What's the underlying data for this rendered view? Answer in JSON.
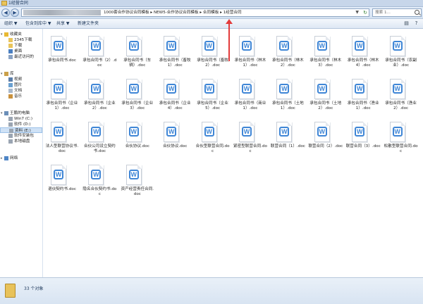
{
  "window": {
    "title": "1经营合同"
  },
  "address": {
    "path_segments": [
      "1000套合作协议合同模板",
      "NEW5-合作协议合同模板",
      "合同模板",
      "1经营合同"
    ],
    "separator": "▸",
    "dropdown": "▼",
    "refresh": "↻"
  },
  "search": {
    "placeholder": "搜索 1..."
  },
  "nav_buttons": {
    "back": "◀",
    "forward": "▶"
  },
  "commands": {
    "organize": "组织 ▼",
    "include_in_library": "包含到库中 ▼",
    "share": "共享 ▼",
    "new_folder": "新建文件夹",
    "view": "▤",
    "help": "?"
  },
  "sidebar": {
    "items": [
      {
        "label": "收藏夹",
        "icon": "star-icon",
        "group": true,
        "expand": "▾"
      },
      {
        "label": "2345下载",
        "icon": "download-folder-icon"
      },
      {
        "label": "下载",
        "icon": "download-folder-icon"
      },
      {
        "label": "桌面",
        "icon": "desktop-icon"
      },
      {
        "label": "最近访问的",
        "icon": "recent-icon"
      },
      {
        "label": "库",
        "icon": "library-icon",
        "group": true,
        "expand": "▾"
      },
      {
        "label": "视频",
        "icon": "video-icon"
      },
      {
        "label": "图片",
        "icon": "picture-icon"
      },
      {
        "label": "文档",
        "icon": "document-icon"
      },
      {
        "label": "音乐",
        "icon": "music-icon"
      },
      {
        "label": "王鹏的电脑",
        "icon": "computer-icon",
        "group": true,
        "expand": "▾"
      },
      {
        "label": "Win7 (C:)",
        "icon": "drive-icon"
      },
      {
        "label": "软件 (D:)",
        "icon": "drive-icon"
      },
      {
        "label": "资料 (E:)",
        "icon": "drive-icon",
        "selected": true
      },
      {
        "label": "软件安装包",
        "icon": "drive-icon"
      },
      {
        "label": "本地磁盘",
        "icon": "drive-icon"
      },
      {
        "label": "网络",
        "icon": "network-icon",
        "group": true,
        "expand": "▸"
      }
    ]
  },
  "files": [
    {
      "name": "承包合同书.doc"
    },
    {
      "name": "承包合同书（2）.doc"
    },
    {
      "name": "承包合同书（车辆）.doc"
    },
    {
      "name": "承包合同书（畜牧1）.doc"
    },
    {
      "name": "承包合同书（畜牧2）.doc"
    },
    {
      "name": "承包合同书（林木1）.doc"
    },
    {
      "name": "承包合同书（林木2）.doc"
    },
    {
      "name": "承包合同书（林木3）.doc"
    },
    {
      "name": "承包合同书（林木4）.doc"
    },
    {
      "name": "承包合同书（农副业）.doc"
    },
    {
      "name": "承包合同书（企业1）.doc"
    },
    {
      "name": "承包合同书（企业2）.doc"
    },
    {
      "name": "承包合同书（企业3）.doc"
    },
    {
      "name": "承包合同书（企业4）.doc"
    },
    {
      "name": "承包合同书（企业5）.doc"
    },
    {
      "name": "承包合同书（商业1）.doc"
    },
    {
      "name": "承包合同书（土地1）.doc"
    },
    {
      "name": "承包合同书（土地2）.doc"
    },
    {
      "name": "承包合同书（渔业1）.doc"
    },
    {
      "name": "承包合同书（渔业2）.doc"
    },
    {
      "name": "法人型联营协议书.doc"
    },
    {
      "name": "合伙公司设立契约书.doc"
    },
    {
      "name": "合伙协议.doc"
    },
    {
      "name": "合伙协议.doc"
    },
    {
      "name": "合伙型联营合同.doc"
    },
    {
      "name": "紧密型联营合同.doc"
    },
    {
      "name": "联营合同（1）.doc"
    },
    {
      "name": "联营合同（2）.doc"
    },
    {
      "name": "联营合同（3）.doc"
    },
    {
      "name": "松散型联营合同.doc"
    },
    {
      "name": "退伙契约书.doc"
    },
    {
      "name": "隐名合伙契约书.doc"
    },
    {
      "name": "资产经营责任合同.doc"
    }
  ],
  "file_icon": {
    "glyph": "W",
    "color": "#3f86d6"
  },
  "status": {
    "count_text": "33 个对象"
  },
  "colors": {
    "accent": "#3f86d6",
    "annotation_arrow": "#e33b3b",
    "selection": "#cfe2f6"
  }
}
